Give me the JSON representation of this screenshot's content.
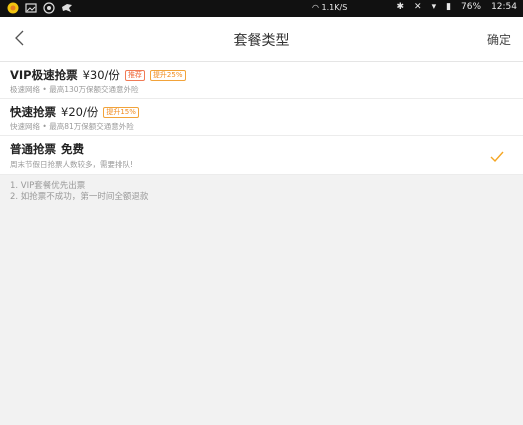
{
  "statusbar": {
    "speed": "1.1K/S",
    "battery": "76%",
    "time": "12:54"
  },
  "nav": {
    "title": "套餐类型",
    "confirm": "确定"
  },
  "options": [
    {
      "name": "VIP极速抢票",
      "price": "¥30/份",
      "tag1": "推荐",
      "tag2": "提升25%",
      "desc": "极速网络 • 最高130万保额交通意外险",
      "selected": false
    },
    {
      "name": "快速抢票",
      "price": "¥20/份",
      "tag1": "提升15%",
      "desc": "快速网络 • 最高81万保额交通意外险",
      "selected": false
    },
    {
      "name": "普通抢票",
      "price": "免费",
      "desc": "周末节假日抢票人数较多，需要排队!",
      "selected": true
    }
  ],
  "notes": [
    "1. VIP套餐优先出票",
    "2. 如抢票不成功，第一时间全额退款"
  ],
  "colors": {
    "accent": "#f5a623",
    "tag_red": "#ef6a3c"
  }
}
